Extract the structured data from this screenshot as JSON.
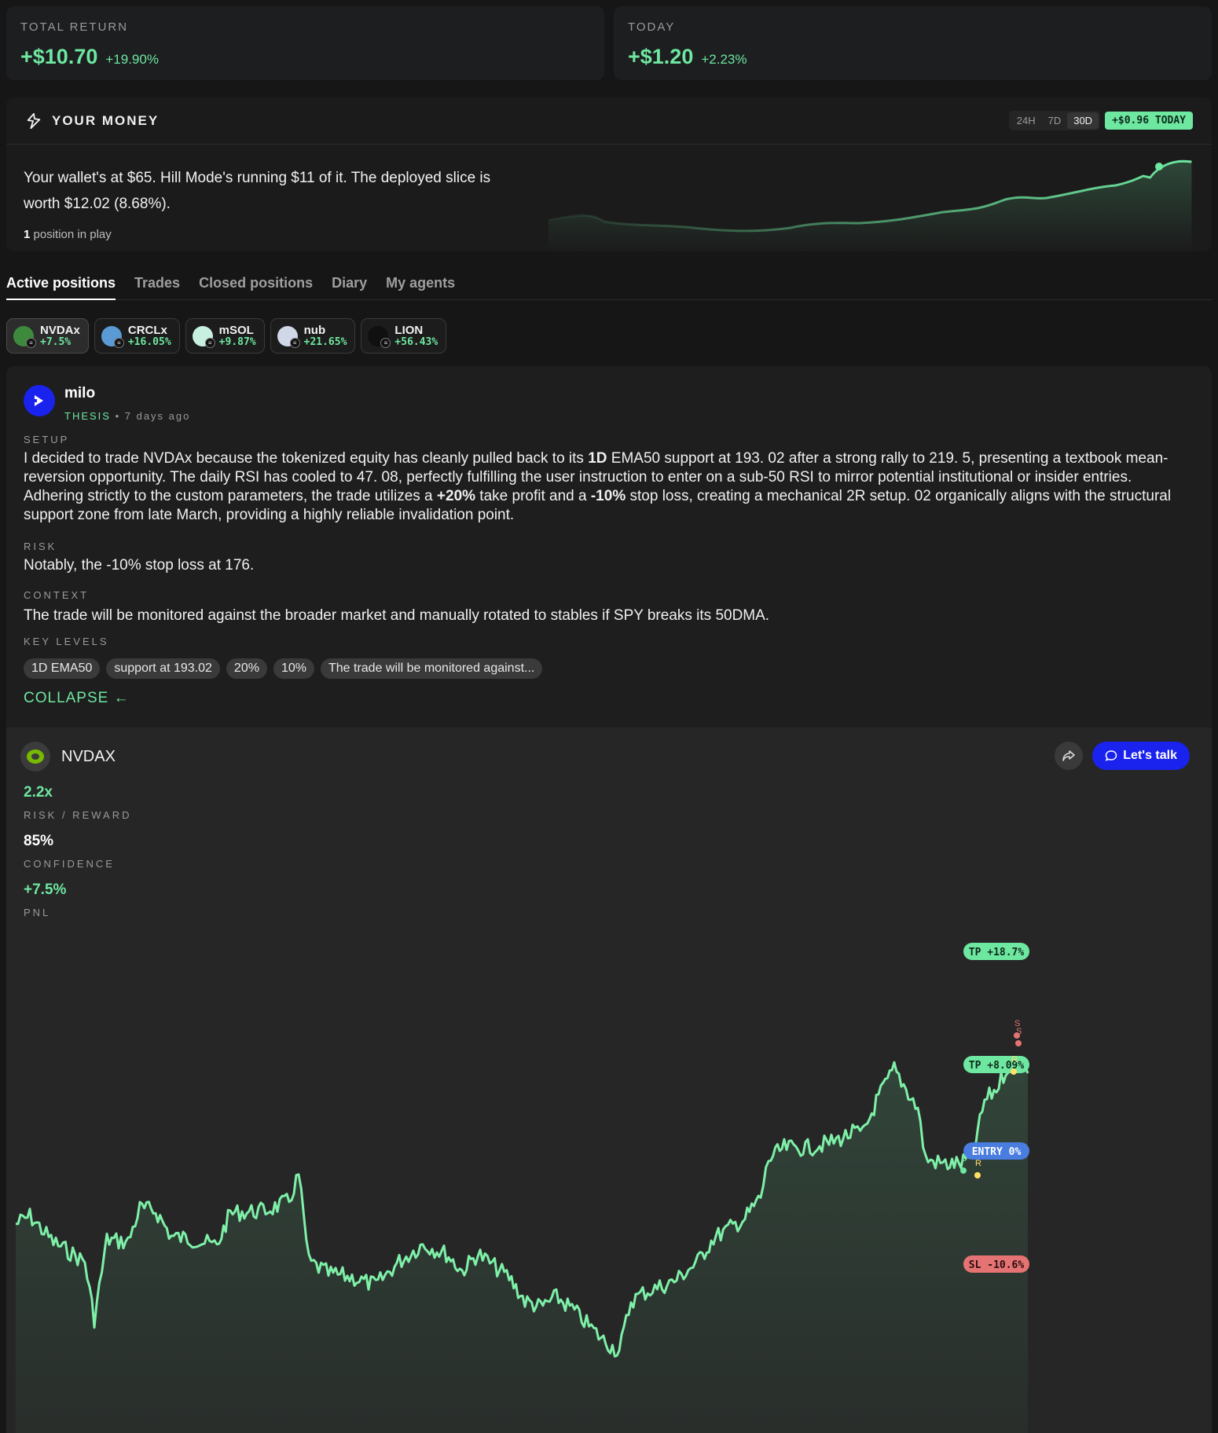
{
  "stats": [
    {
      "label": "TOTAL RETURN",
      "value": "+$10.70",
      "pct": "+19.90%"
    },
    {
      "label": "TODAY",
      "value": "+$1.20",
      "pct": "+2.23%"
    }
  ],
  "money": {
    "title": "YOUR MONEY",
    "ranges": [
      "24H",
      "7D",
      "30D"
    ],
    "active_range": "30D",
    "today_badge": "+$0.96 TODAY",
    "summary": "Your wallet's at $65. Hill Mode's running $11 of it. The deployed slice is worth $12.02 (8.68%).",
    "positions_count": "1",
    "positions_suffix": " position in play"
  },
  "tabs": [
    "Active positions",
    "Trades",
    "Closed positions",
    "Diary",
    "My agents"
  ],
  "chips": [
    {
      "name": "NVDAx",
      "pct": "+7.5%",
      "logo_color": "#3d8a3d",
      "sub": "≡"
    },
    {
      "name": "CRCLx",
      "pct": "+16.05%",
      "logo_color": "#5b9bd5",
      "sub": "≡"
    },
    {
      "name": "mSOL",
      "pct": "+9.87%",
      "logo_color": "#c8f0e0",
      "sub": "≡"
    },
    {
      "name": "nub",
      "pct": "+21.65%",
      "logo_color": "#d0d8e8",
      "sub": "≡"
    },
    {
      "name": "LION",
      "pct": "+56.43%",
      "logo_color": "#101010",
      "sub": "≡"
    }
  ],
  "thesis": {
    "author": "milo",
    "tag": "THESIS",
    "time": " • 7 days ago",
    "setup_label": "SETUP",
    "setup_text_parts": [
      "I decided to trade NVDAx because the tokenized equity has cleanly pulled back to its ",
      "1D",
      " EMA50 support at 193. 02 after a strong rally to 219. 5, presenting a textbook mean-reversion opportunity. The daily RSI has cooled to 47. 08, perfectly fulfilling the user instruction to enter on a sub-50 RSI to mirror potential institutional or insider entries. Adhering strictly to the custom parameters, the trade utilizes a ",
      "+20%",
      " take profit and a ",
      "-10%",
      " stop loss, creating a mechanical 2R setup. 02 organically aligns with the structural support zone from late March, providing a highly reliable invalidation point."
    ],
    "risk_label": "RISK",
    "risk_text": "Notably, the -10% stop loss at 176.",
    "context_label": "CONTEXT",
    "context_text": "The trade will be monitored against the broader market and manually rotated to stables if SPY breaks its 50DMA.",
    "key_levels_label": "KEY LEVELS",
    "key_levels": [
      "1D EMA50",
      "support at 193.02",
      "20%",
      "10%",
      "The trade will be monitored against..."
    ],
    "collapse": "COLLAPSE ←"
  },
  "position": {
    "symbol": "NVDAX",
    "talk": "Let's talk",
    "metrics": [
      {
        "value": "2.2x",
        "label": "RISK / REWARD",
        "color": "#6ee7a0"
      },
      {
        "value": "85%",
        "label": "CONFIDENCE",
        "color": "#ffffff"
      },
      {
        "value": "+7.5%",
        "label": "PNL",
        "color": "#6ee7a0"
      }
    ]
  },
  "chart_data": {
    "type": "line",
    "title": "",
    "xlabel": "",
    "ylabel": "",
    "levels": [
      {
        "label": "TP +18.7%",
        "kind": "tp"
      },
      {
        "label": "TP +8.09%",
        "kind": "tp"
      },
      {
        "label": "ENTRY 0%",
        "kind": "entry"
      },
      {
        "label": "SL -10.6%",
        "kind": "sl"
      }
    ],
    "markers": [
      "B",
      "R",
      "R",
      "S",
      "S"
    ],
    "colors": {
      "line": "#7ef0a8",
      "tp": "#6ee7a0",
      "entry": "#4a7de0",
      "sl": "#e57373"
    }
  }
}
